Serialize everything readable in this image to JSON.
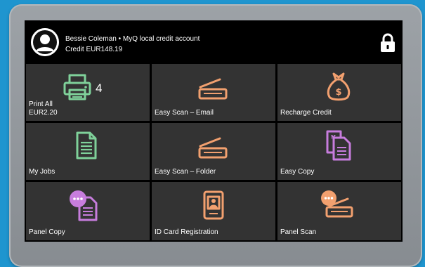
{
  "header": {
    "user_line": "Bessie Coleman • MyQ local credit account",
    "credit_line": "Credit EUR148.19"
  },
  "tiles": [
    {
      "id": "print-all",
      "label_line1": "Print All",
      "label_line2": "EUR2.20",
      "count": "4",
      "icon": "printer-icon",
      "color": "#7fd19a"
    },
    {
      "id": "easy-scan-email",
      "label": "Easy Scan – Email",
      "icon": "scanner-icon",
      "color": "#f2a06f"
    },
    {
      "id": "recharge-credit",
      "label": "Recharge Credit",
      "icon": "money-bag-icon",
      "color": "#f2a06f"
    },
    {
      "id": "my-jobs",
      "label": "My Jobs",
      "icon": "document-icon",
      "color": "#7fd19a"
    },
    {
      "id": "easy-scan-folder",
      "label": "Easy Scan – Folder",
      "icon": "scanner-icon",
      "color": "#f2a06f"
    },
    {
      "id": "easy-copy",
      "label": "Easy Copy",
      "icon": "copy-icon",
      "color": "#c77ddd"
    },
    {
      "id": "panel-copy",
      "label": "Panel Copy",
      "icon": "panel-copy-icon",
      "color": "#c77ddd"
    },
    {
      "id": "id-card-registration",
      "label": "ID Card Registration",
      "icon": "id-card-icon",
      "color": "#f2a06f"
    },
    {
      "id": "panel-scan",
      "label": "Panel Scan",
      "icon": "panel-scan-icon",
      "color": "#f2a06f"
    }
  ],
  "colors": {
    "background": "#1f95cf",
    "tile": "#333333",
    "screen": "#000000",
    "green": "#7fd19a",
    "orange": "#f2a06f",
    "purple": "#c77ddd"
  }
}
